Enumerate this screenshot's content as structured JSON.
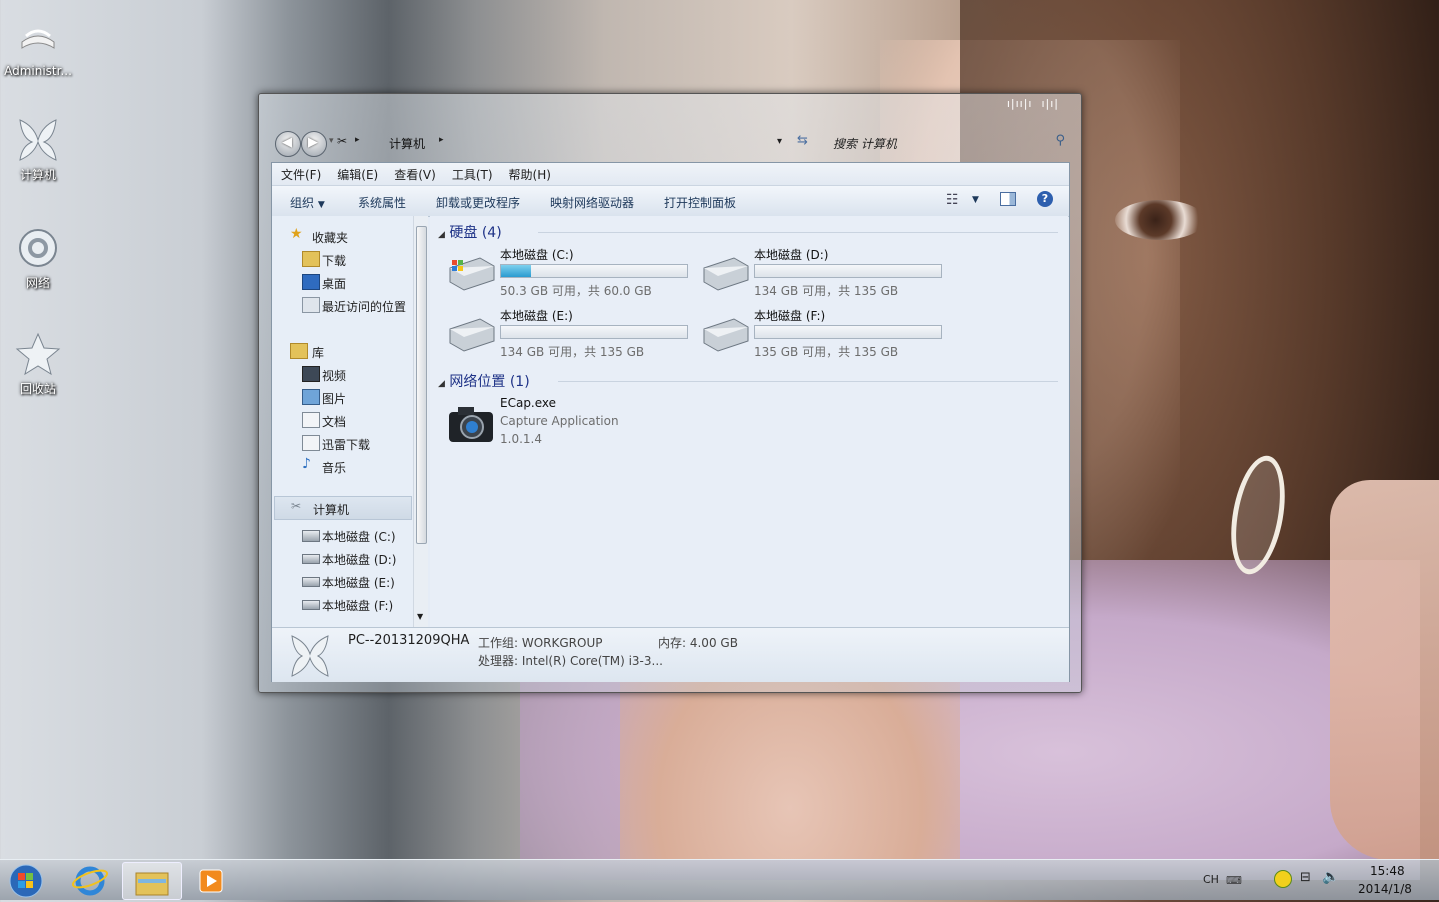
{
  "desktop": {
    "icons": [
      {
        "label": "Administr...",
        "icon": "user-folder-icon"
      },
      {
        "label": "计算机",
        "icon": "computer-icon"
      },
      {
        "label": "网络",
        "icon": "network-icon"
      },
      {
        "label": "回收站",
        "icon": "recycle-bin-icon"
      }
    ]
  },
  "window": {
    "address": {
      "crumb": "计算机",
      "search_placeholder": "搜索 计算机"
    },
    "menu": [
      "文件(F)",
      "编辑(E)",
      "查看(V)",
      "工具(T)",
      "帮助(H)"
    ],
    "commands": [
      "组织",
      "系统属性",
      "卸载或更改程序",
      "映射网络驱动器",
      "打开控制面板"
    ],
    "nav": {
      "favorites": {
        "label": "收藏夹",
        "items": [
          "下载",
          "桌面",
          "最近访问的位置"
        ]
      },
      "libraries": {
        "label": "库",
        "items": [
          "视频",
          "图片",
          "文档",
          "迅雷下载",
          "音乐"
        ]
      },
      "computer": {
        "label": "计算机",
        "items": [
          "本地磁盘 (C:)",
          "本地磁盘 (D:)",
          "本地磁盘 (E:)",
          "本地磁盘 (F:)"
        ]
      }
    },
    "groups": {
      "drives_title": "硬盘 (4)",
      "network_title": "网络位置 (1)"
    },
    "drives": [
      {
        "name": "本地磁盘 (C:)",
        "info": "50.3 GB 可用，共 60.0 GB",
        "used_fraction": 0.16
      },
      {
        "name": "本地磁盘 (D:)",
        "info": "134 GB 可用，共 135 GB",
        "used_fraction": 0.0
      },
      {
        "name": "本地磁盘 (E:)",
        "info": "134 GB 可用，共 135 GB",
        "used_fraction": 0.0
      },
      {
        "name": "本地磁盘 (F:)",
        "info": "135 GB 可用，共 135 GB",
        "used_fraction": 0.0
      }
    ],
    "network_item": {
      "name": "ECap.exe",
      "desc": "Capture Application",
      "version": "1.0.1.4"
    },
    "status": {
      "pc_name": "PC--20131209QHA",
      "workgroup": "工作组: WORKGROUP",
      "memory": "内存: 4.00 GB",
      "cpu": "处理器: Intel(R) Core(TM) i3-3..."
    }
  },
  "taskbar": {
    "lang": "CH",
    "time": "15:48",
    "date": "2014/1/8"
  }
}
